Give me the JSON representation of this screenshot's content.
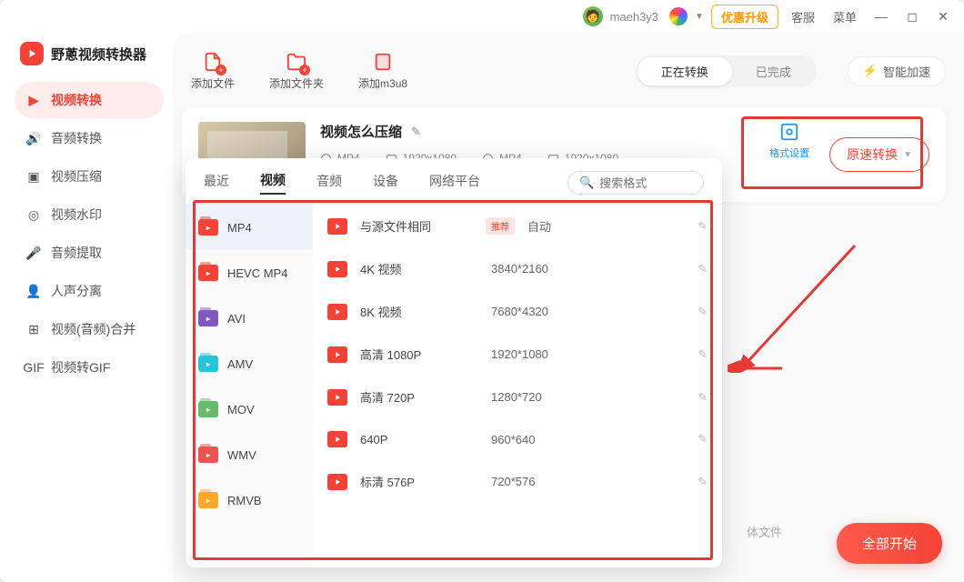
{
  "titlebar": {
    "username": "maeh3y3",
    "upgrade": "优惠升级",
    "support": "客服",
    "menu": "菜单"
  },
  "app": {
    "name": "野蔥视频转换器"
  },
  "sidebar": {
    "items": [
      {
        "label": "视频转换"
      },
      {
        "label": "音频转换"
      },
      {
        "label": "视频压缩"
      },
      {
        "label": "视频水印"
      },
      {
        "label": "音频提取"
      },
      {
        "label": "人声分离"
      },
      {
        "label": "视频(音频)合并"
      },
      {
        "label": "视频转GIF"
      }
    ]
  },
  "toolbar": {
    "add_file": "添加文件",
    "add_folder": "添加文件夹",
    "add_m3u8": "添加m3u8",
    "tab_converting": "正在转换",
    "tab_done": "已完成",
    "smart_accel": "智能加速"
  },
  "file": {
    "title": "视频怎么压缩",
    "src_fmt": "MP4",
    "src_res": "1920x1080",
    "dst_fmt": "MP4",
    "dst_res": "1920x1080",
    "settings_label": "格式设置",
    "convert_btn": "原速转换"
  },
  "popup": {
    "tabs": {
      "recent": "最近",
      "video": "视频",
      "audio": "音频",
      "device": "设备",
      "web": "网络平台"
    },
    "search_placeholder": "搜索格式",
    "formats": [
      {
        "name": "MP4",
        "color": "#f44336"
      },
      {
        "name": "HEVC MP4",
        "color": "#f44336"
      },
      {
        "name": "AVI",
        "color": "#7e57c2"
      },
      {
        "name": "AMV",
        "color": "#26c6da"
      },
      {
        "name": "MOV",
        "color": "#66bb6a"
      },
      {
        "name": "WMV",
        "color": "#ef5350"
      },
      {
        "name": "RMVB",
        "color": "#ffa726"
      }
    ],
    "resolutions": [
      {
        "label": "与源文件相同",
        "badge": "推荐",
        "dim": "自动"
      },
      {
        "label": "4K 视频",
        "dim": "3840*2160"
      },
      {
        "label": "8K 视频",
        "dim": "7680*4320"
      },
      {
        "label": "高清 1080P",
        "dim": "1920*1080"
      },
      {
        "label": "高清 720P",
        "dim": "1280*720"
      },
      {
        "label": "640P",
        "dim": "960*640"
      },
      {
        "label": "标清 576P",
        "dim": "720*576"
      }
    ]
  },
  "footer": {
    "hint": "体文件",
    "start_all": "全部开始"
  }
}
